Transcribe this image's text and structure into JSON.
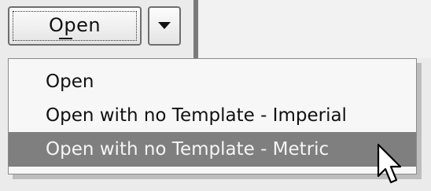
{
  "toolbar": {
    "open_label": "Open"
  },
  "menu": {
    "items": [
      {
        "label": "Open",
        "selected": false
      },
      {
        "label": "Open with no Template - Imperial",
        "selected": false
      },
      {
        "label": "Open with no Template - Metric",
        "selected": true
      }
    ]
  },
  "icons": {
    "dropdown": "chevron-down-icon",
    "cursor": "mouse-pointer-icon"
  },
  "colors": {
    "selected_bg": "#7f7f7f",
    "selected_text": "#f5f5f5",
    "menu_bg": "#f7f7f7"
  }
}
